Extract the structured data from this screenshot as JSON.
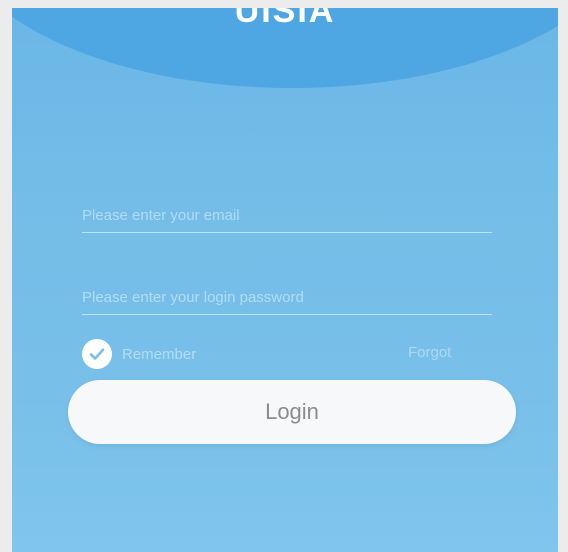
{
  "app": {
    "title": "UISIA"
  },
  "form": {
    "email_placeholder": "Please enter your email",
    "password_placeholder": "Please enter your login password",
    "remember_label": "Remember",
    "forgot_label": "Forgot",
    "remember_checked": true,
    "login_label": "Login"
  },
  "colors": {
    "background": "#78c0ea",
    "header_wave": "#4ea6e3",
    "button": "#f7f8fa",
    "button_text": "#8c8c8c"
  },
  "icons": {
    "remember_check": "checkmark-circle-icon"
  }
}
